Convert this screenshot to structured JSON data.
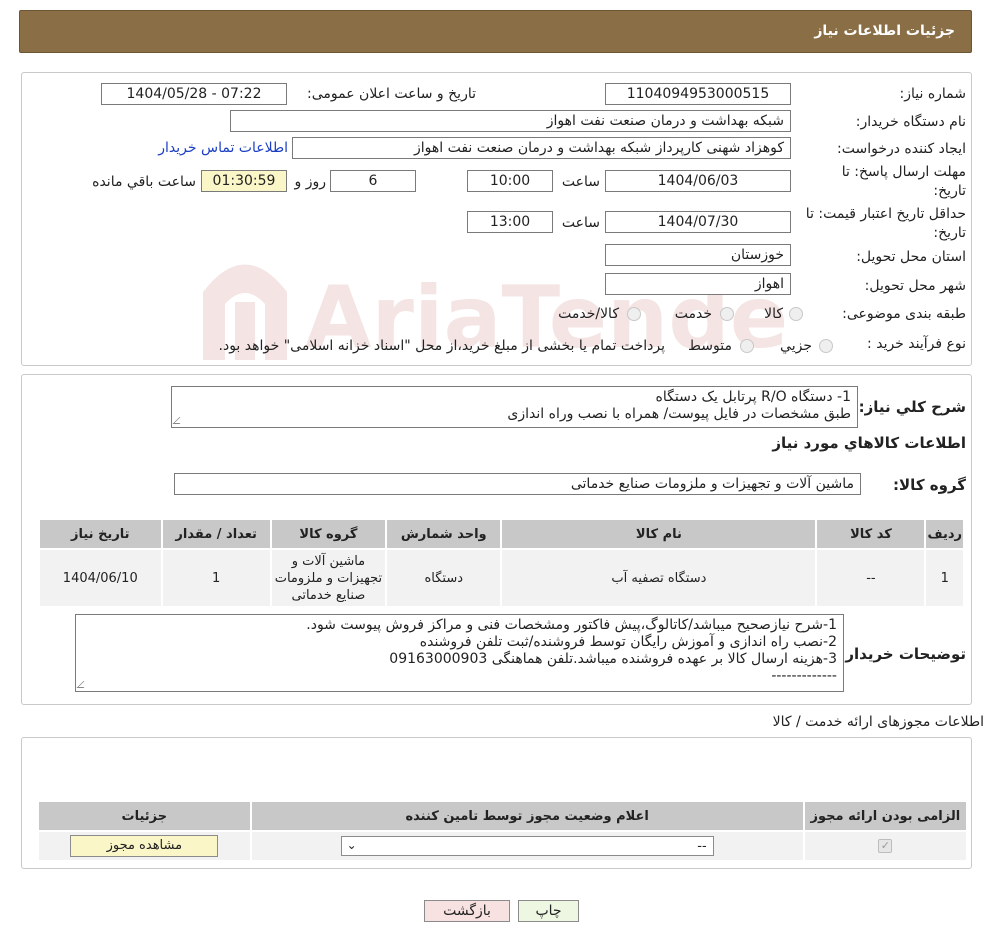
{
  "header": {
    "title": "جزئیات اطلاعات نیاز"
  },
  "form": {
    "need_number_label": "شماره نیاز:",
    "need_number": "1104094953000515",
    "announce_label": "تاریخ و ساعت اعلان عمومی:",
    "announce_value": "1404/05/28 - 07:22",
    "buyer_org_label": "نام دستگاه خریدار:",
    "buyer_org": "شبکه بهداشت و درمان صنعت نفت اهواز",
    "creator_label": "ایجاد کننده درخواست:",
    "creator": "کوهزاد شهنی کارپرداز شبکه بهداشت و درمان صنعت نفت اهواز",
    "contact_link": "اطلاعات تماس خریدار",
    "deadline_label_1": "مهلت ارسال پاسخ: تا",
    "deadline_label_2": "تاریخ:",
    "deadline_date": "1404/06/03",
    "time_label": "ساعت",
    "deadline_time": "10:00",
    "days_value": "6",
    "days_label": "روز و",
    "remaining_time": "01:30:59",
    "remaining_label": "ساعت باقي مانده",
    "validity_label_1": "حداقل تاریخ اعتبار قیمت: تا",
    "validity_label_2": "تاریخ:",
    "validity_date": "1404/07/30",
    "validity_time": "13:00",
    "province_label": "استان محل تحویل:",
    "province": "خوزستان",
    "city_label": "شهر محل تحویل:",
    "city": "اهواز",
    "category_label": "طبقه بندی موضوعی:",
    "category_options": [
      "کالا",
      "خدمت",
      "کالا/خدمت"
    ],
    "process_label": "نوع فرآیند خرید :",
    "process_options": [
      "جزیي",
      "متوسط"
    ],
    "process_note": "پرداخت تمام یا بخشی از مبلغ خرید،از محل \"اسناد خزانه اسلامی\" خواهد بود."
  },
  "summary": {
    "label": "شرح كلي نياز:",
    "lines": [
      "1- دستگاه R/O پرتابل  یک دستگاه",
      "طبق مشخصات در فایل پیوست/ همراه با نصب وراه اندازی"
    ]
  },
  "goods": {
    "title": "اطلاعات كالاهاي مورد نياز",
    "group_label": "گروه کالا:",
    "group_value": "ماشین آلات و تجهیزات و ملزومات صنایع خدماتی",
    "columns": [
      "ردیف",
      "کد کالا",
      "نام کالا",
      "واحد شمارش",
      "گروه کالا",
      "تعداد / مقدار",
      "تاریخ نیاز"
    ],
    "rows": [
      {
        "index": "1",
        "code": "--",
        "name": "دستگاه تصفیه آب",
        "unit": "دستگاه",
        "group_lines": [
          "ماشین آلات و",
          "تجهیزات و ملزومات",
          "صنایع خدماتی"
        ],
        "qty": "1",
        "date": "1404/06/10"
      }
    ]
  },
  "buyer_notes": {
    "label": "توضیحات خریدار:",
    "lines": [
      "1-شرح نیازصحیح میباشد/کاتالوگ،پیش فاکتور ومشخصات فنی و مراکز فروش پیوست شود.",
      "2-نصب راه اندازی و آموزش رایگان توسط فروشنده/ثبت تلفن فروشنده",
      "3-هزینه ارسال کالا بر عهده فروشنده میباشد.تلفن هماهنگی 09163000903",
      "-------------"
    ]
  },
  "permits": {
    "title": "اطلاعات مجوزهای ارائه خدمت / کالا",
    "columns": [
      "الزامی بودن ارائه مجوز",
      "اعلام وضعیت مجوز توسط تامین کننده",
      "جزئیات"
    ],
    "select_value": "--",
    "view_button": "مشاهده مجوز"
  },
  "actions": {
    "print": "چاپ",
    "back": "بازگشت"
  },
  "watermark": {
    "text": "AriaTender.neT"
  }
}
